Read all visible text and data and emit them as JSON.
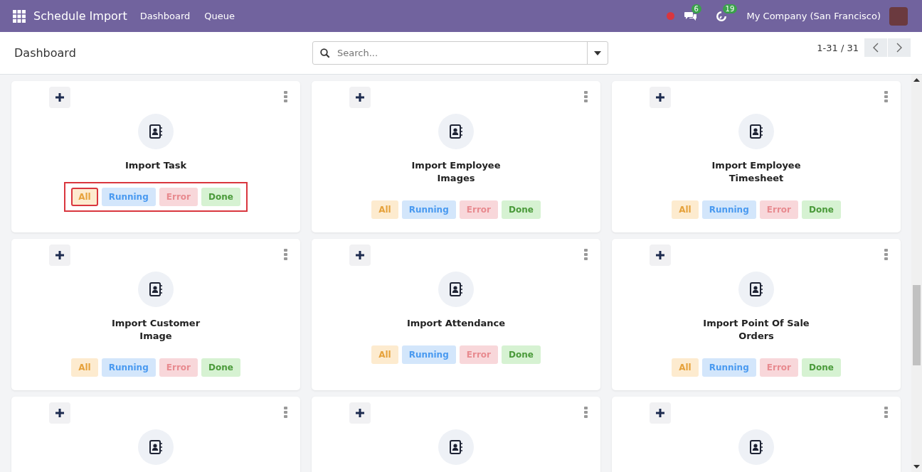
{
  "navbar": {
    "app_title": "Schedule Import",
    "menu": [
      {
        "label": "Dashboard"
      },
      {
        "label": "Queue"
      }
    ],
    "messages_badge": "6",
    "activities_badge": "19",
    "company": "My Company (San Francisco)"
  },
  "control_panel": {
    "breadcrumb": "Dashboard",
    "search": {
      "placeholder": "Search..."
    },
    "pager": "1-31 / 31"
  },
  "cards": [
    {
      "kind": "full",
      "title": "Import Task",
      "highlighted": true,
      "statuses": [
        {
          "label": "All",
          "kind": "all",
          "highlighted": true
        },
        {
          "label": "Running",
          "kind": "running",
          "highlighted": false
        },
        {
          "label": "Error",
          "kind": "error",
          "highlighted": false
        },
        {
          "label": "Done",
          "kind": "done",
          "highlighted": false
        }
      ]
    },
    {
      "kind": "full",
      "title": "Import Employee Images",
      "highlighted": false,
      "statuses": [
        {
          "label": "All",
          "kind": "all",
          "highlighted": false
        },
        {
          "label": "Running",
          "kind": "running",
          "highlighted": false
        },
        {
          "label": "Error",
          "kind": "error",
          "highlighted": false
        },
        {
          "label": "Done",
          "kind": "done",
          "highlighted": false
        }
      ]
    },
    {
      "kind": "full",
      "title": "Import Employee Timesheet",
      "highlighted": false,
      "statuses": [
        {
          "label": "All",
          "kind": "all",
          "highlighted": false
        },
        {
          "label": "Running",
          "kind": "running",
          "highlighted": false
        },
        {
          "label": "Error",
          "kind": "error",
          "highlighted": false
        },
        {
          "label": "Done",
          "kind": "done",
          "highlighted": false
        }
      ]
    },
    {
      "kind": "full",
      "title": "Import Customer Image",
      "highlighted": false,
      "statuses": [
        {
          "label": "All",
          "kind": "all",
          "highlighted": false
        },
        {
          "label": "Running",
          "kind": "running",
          "highlighted": false
        },
        {
          "label": "Error",
          "kind": "error",
          "highlighted": false
        },
        {
          "label": "Done",
          "kind": "done",
          "highlighted": false
        }
      ]
    },
    {
      "kind": "full",
      "title": "Import Attendance",
      "highlighted": false,
      "statuses": [
        {
          "label": "All",
          "kind": "all",
          "highlighted": false
        },
        {
          "label": "Running",
          "kind": "running",
          "highlighted": false
        },
        {
          "label": "Error",
          "kind": "error",
          "highlighted": false
        },
        {
          "label": "Done",
          "kind": "done",
          "highlighted": false
        }
      ]
    },
    {
      "kind": "full",
      "title": "Import Point Of Sale Orders",
      "highlighted": false,
      "statuses": [
        {
          "label": "All",
          "kind": "all",
          "highlighted": false
        },
        {
          "label": "Running",
          "kind": "running",
          "highlighted": false
        },
        {
          "label": "Error",
          "kind": "error",
          "highlighted": false
        },
        {
          "label": "Done",
          "kind": "done",
          "highlighted": false
        }
      ]
    },
    {
      "kind": "cut_off"
    },
    {
      "kind": "cut_off"
    },
    {
      "kind": "cut_off"
    }
  ]
}
